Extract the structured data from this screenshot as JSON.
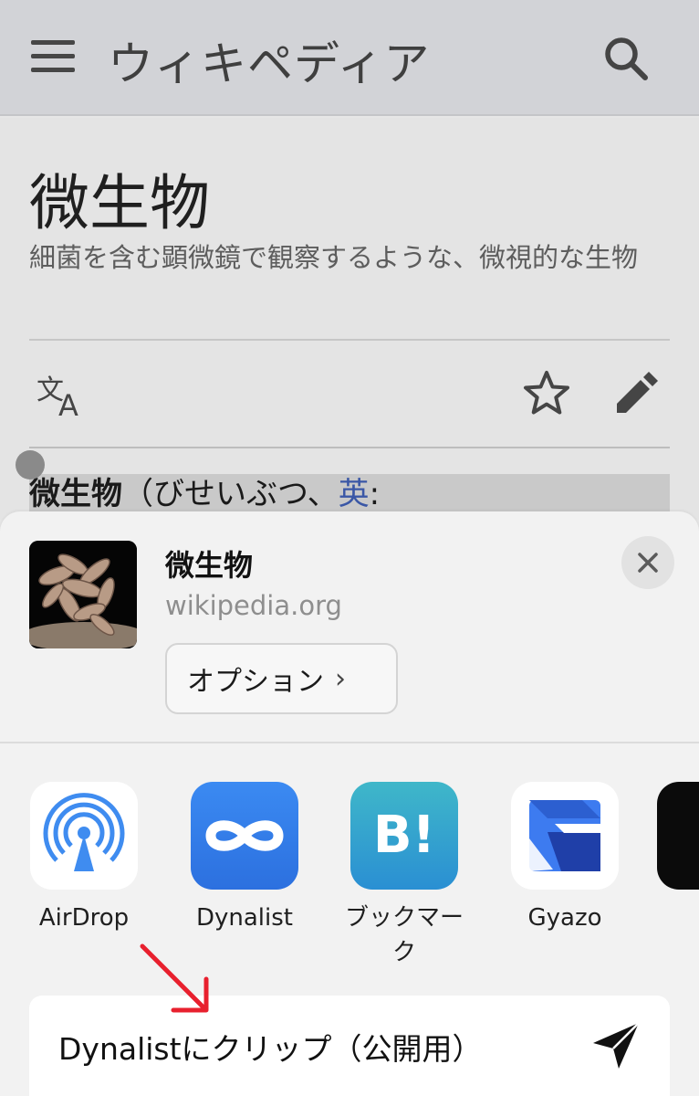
{
  "header": {
    "logo_text": "ウィキペディア",
    "menu_icon": "hamburger-menu-icon",
    "search_icon": "search-icon"
  },
  "article": {
    "title": "微生物",
    "description": "細菌を含む顕微鏡で観察するような、微視的な生物",
    "first_line_bold": "微生物",
    "first_line_text": "（びせいぶつ、",
    "first_line_link": "英",
    "first_line_after": ":",
    "toolbar_icons": [
      "language-icon",
      "star-icon",
      "edit-icon"
    ]
  },
  "share_sheet": {
    "title": "微生物",
    "domain": "wikipedia.org",
    "options_label": "オプション",
    "options_chevron": "›",
    "close_icon": "close-icon",
    "apps": [
      {
        "label": "AirDrop",
        "icon": "airdrop-icon"
      },
      {
        "label": "Dynalist",
        "icon": "dynalist-icon"
      },
      {
        "label": "ブックマーク",
        "icon": "hatena-bookmark-icon"
      },
      {
        "label": "Gyazo",
        "icon": "gyazo-icon"
      }
    ],
    "hatena_glyph": "B!",
    "action_label": "Dynalistにクリップ（公開用）",
    "action_icon": "send-icon"
  },
  "colors": {
    "accent_red": "#e8202e",
    "link_blue": "#3a57a6",
    "dynalist_blue": "#2c70df"
  }
}
